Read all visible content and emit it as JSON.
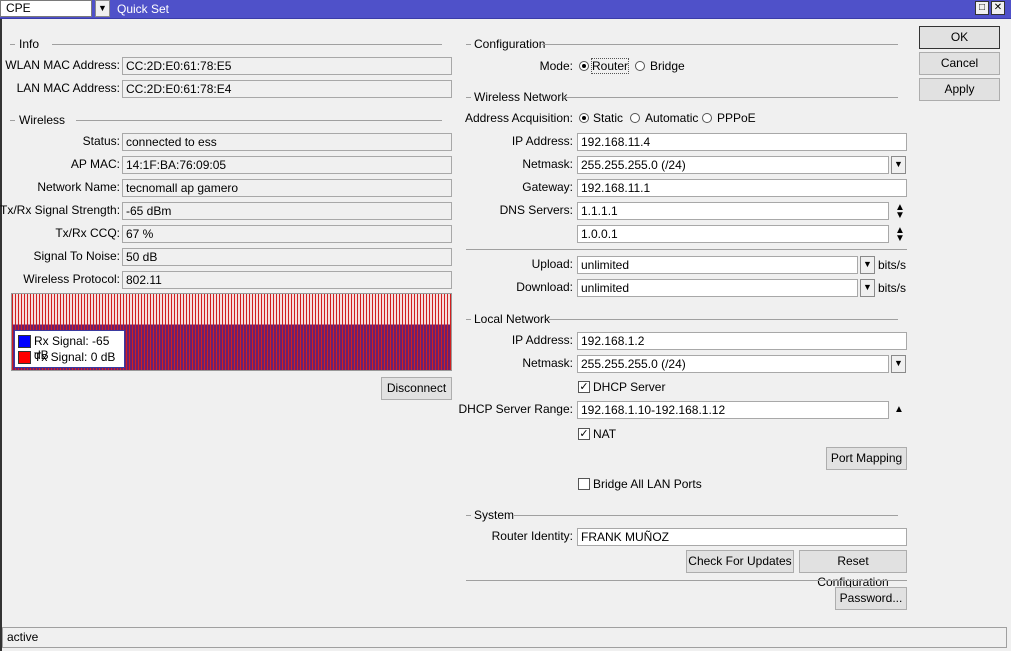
{
  "window": {
    "preset": "CPE",
    "title": "Quick Set"
  },
  "info": {
    "legend": "Info",
    "wlan_mac_label": "WLAN MAC Address:",
    "wlan_mac": "CC:2D:E0:61:78:E5",
    "lan_mac_label": "LAN MAC Address:",
    "lan_mac": "CC:2D:E0:61:78:E4"
  },
  "wireless": {
    "legend": "Wireless",
    "rows": [
      {
        "label": "Status:",
        "value": "connected to ess"
      },
      {
        "label": "AP MAC:",
        "value": "14:1F:BA:76:09:05"
      },
      {
        "label": "Network Name:",
        "value": "tecnomall ap gamero"
      },
      {
        "label": "Tx/Rx Signal Strength:",
        "value": "-65 dBm"
      },
      {
        "label": "Tx/Rx CCQ:",
        "value": "67 %"
      },
      {
        "label": "Signal To Noise:",
        "value": "50 dB"
      },
      {
        "label": "Wireless Protocol:",
        "value": "802.11"
      }
    ],
    "graph": {
      "rx_label": "Rx Signal:  -65 dB",
      "tx_label": "Tx Signal:  0 dB",
      "rx_color": "#0000ff",
      "tx_color": "#ff0000"
    },
    "disconnect": "Disconnect"
  },
  "configuration": {
    "legend": "Configuration",
    "mode_label": "Mode:",
    "modes": [
      "Router",
      "Bridge"
    ],
    "mode_selected": "Router"
  },
  "wireless_network": {
    "legend": "Wireless Network",
    "acq_label": "Address Acquisition:",
    "acq_options": [
      "Static",
      "Automatic",
      "PPPoE"
    ],
    "acq_selected": "Static",
    "ip_label": "IP Address:",
    "ip": "192.168.11.4",
    "netmask_label": "Netmask:",
    "netmask": "255.255.255.0 (/24)",
    "gateway_label": "Gateway:",
    "gateway": "192.168.11.1",
    "dns_label": "DNS Servers:",
    "dns": [
      "1.1.1.1",
      "1.0.0.1"
    ],
    "upload_label": "Upload:",
    "upload": "unlimited",
    "download_label": "Download:",
    "download": "unlimited",
    "unit": "bits/s"
  },
  "local_network": {
    "legend": "Local Network",
    "ip_label": "IP Address:",
    "ip": "192.168.1.2",
    "netmask_label": "Netmask:",
    "netmask": "255.255.255.0 (/24)",
    "dhcp_server": "DHCP Server",
    "dhcp_server_checked": true,
    "dhcp_range_label": "DHCP Server Range:",
    "dhcp_range": "192.168.1.10-192.168.1.12",
    "nat": "NAT",
    "nat_checked": true,
    "port_mapping": "Port Mapping",
    "bridge_all": "Bridge All LAN Ports",
    "bridge_all_checked": false
  },
  "system": {
    "legend": "System",
    "identity_label": "Router Identity:",
    "identity": "FRANK MUÑOZ",
    "check_updates": "Check For Updates",
    "reset": "Reset Configuration",
    "password": "Password..."
  },
  "actions": {
    "ok": "OK",
    "cancel": "Cancel",
    "apply": "Apply"
  },
  "status": "active"
}
